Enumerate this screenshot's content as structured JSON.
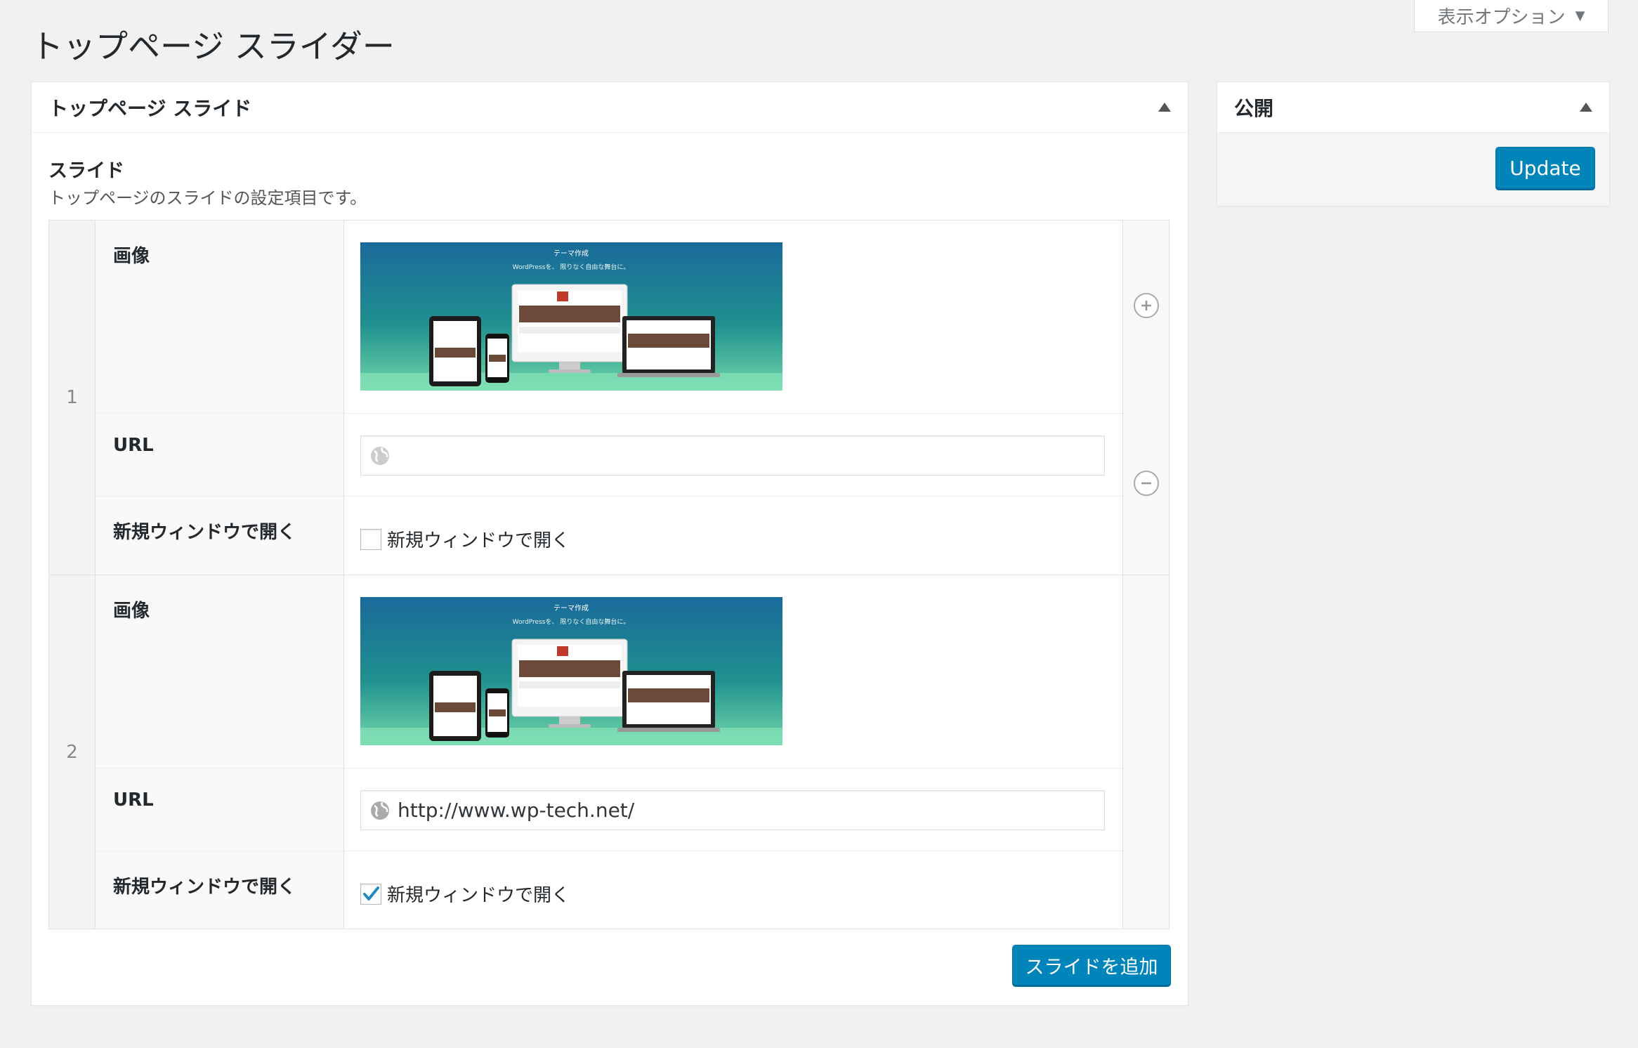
{
  "screen_options": {
    "label": "表示オプション"
  },
  "page": {
    "title": "トップページ スライダー"
  },
  "main_box": {
    "title": "トップページ スライド",
    "field_label": "スライド",
    "field_description": "トップページのスライドの設定項目です。",
    "add_button": "スライドを追加"
  },
  "labels": {
    "image": "画像",
    "url": "URL",
    "new_window": "新規ウィンドウで開く",
    "checkbox_text": "新規ウィンドウで開く"
  },
  "slide_image": {
    "headline": "テーマ作成",
    "subline": "WordPressを、 限りなく自由な舞台に。"
  },
  "rows": [
    {
      "index": "1",
      "url": "",
      "new_window": false
    },
    {
      "index": "2",
      "url": "http://www.wp-tech.net/",
      "new_window": true
    }
  ],
  "side_box": {
    "title": "公開",
    "update_button": "Update"
  },
  "colors": {
    "accent": "#0085ba",
    "background": "#f1f1f1",
    "checkmark": "#1e8cbe"
  },
  "icons": [
    "chevron-down-icon",
    "collapse-arrow-icon",
    "globe-icon",
    "plus-circle-icon",
    "minus-circle-icon",
    "checkmark-icon"
  ]
}
